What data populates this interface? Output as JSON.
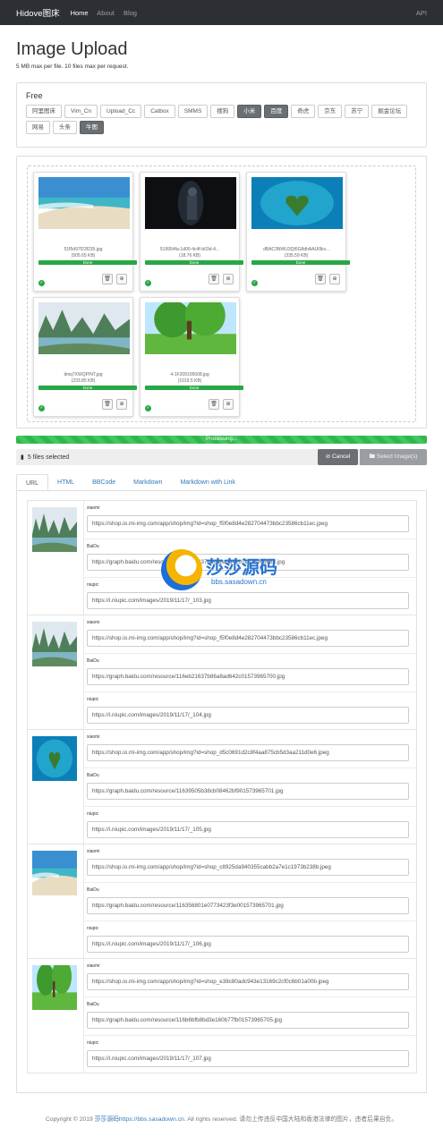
{
  "nav": {
    "brand": "Hidove图床",
    "home": "Home",
    "about": "About",
    "blog": "Blog",
    "api": "API"
  },
  "page": {
    "title": "Image Upload",
    "subtitle": "5 MB max per file. 10 files max per request."
  },
  "hosts": {
    "label": "Free",
    "items": [
      {
        "label": "阿里图床",
        "selected": false
      },
      {
        "label": "Vim_Cn",
        "selected": false
      },
      {
        "label": "Upload_Cc",
        "selected": false
      },
      {
        "label": "Catbox",
        "selected": false
      },
      {
        "label": "SMMS",
        "selected": false
      },
      {
        "label": "搜狗",
        "selected": false
      },
      {
        "label": "小米",
        "selected": true
      },
      {
        "label": "百度",
        "selected": true
      },
      {
        "label": "奇虎",
        "selected": false
      },
      {
        "label": "京东",
        "selected": false
      },
      {
        "label": "苏宁",
        "selected": false
      },
      {
        "label": "掘金论坛",
        "selected": false
      },
      {
        "label": "网易",
        "selected": false
      },
      {
        "label": "头条",
        "selected": false
      },
      {
        "label": "牛图",
        "selected": true
      }
    ]
  },
  "files": [
    {
      "name": "51f5d97f23f235.jpg",
      "size": "(505.65 KB)",
      "status": "Done",
      "progress": 1.0,
      "image": "beach"
    },
    {
      "name": "519954fa-1d00-4c4f-b03d-4...",
      "size": "(18.76 KB)",
      "status": "Done",
      "progress": 1.0,
      "image": "dark-figure"
    },
    {
      "name": "dBAC3NWU3Qt5G8dhAAUl9kv...",
      "size": "(335.59 KB)",
      "status": "Done",
      "progress": 1.0,
      "image": "heart-island"
    },
    {
      "name": "timq7XWQPINT.jpg",
      "size": "(233.85 KB)",
      "status": "Done",
      "progress": 1.0,
      "image": "river-hills"
    },
    {
      "name": "4-1F209105608.jpg",
      "size": "(1019.5 KB)",
      "status": "Done",
      "progress": 1.0,
      "image": "green-tree"
    }
  ],
  "progress": {
    "label": "Processing...",
    "value": 1.0
  },
  "selection": {
    "count_text": "5 files selected",
    "cancel": "Cancel",
    "select": "Select Image(s)"
  },
  "tabs": [
    "URL",
    "HTML",
    "BBCode",
    "Markdown",
    "Markdown with Link"
  ],
  "active_tab": "URL",
  "results": [
    {
      "image": "river-hills",
      "links": [
        {
          "host": "xiaomi",
          "url": "https://shop.io.mi-img.com/app/shop/img?id=shop_f5f0e8d4e282704473bbc23586cb11ec.jpeg"
        },
        {
          "host": "BaiDu",
          "url": "https://graph.baidu.com/resource/116eb21637b86a8ad642c01573965688.jpg"
        },
        {
          "host": "niupic",
          "url": "https://i.niupic.com/images/2019/11/17/_103.jpg"
        }
      ]
    },
    {
      "image": "river-hills",
      "links": [
        {
          "host": "xiaomi",
          "url": "https://shop.io.mi-img.com/app/shop/img?id=shop_f5f0e8d4e282704473bbc23586cb11ec.jpeg"
        },
        {
          "host": "BaiDu",
          "url": "https://graph.baidu.com/resource/116eb21637b86a8ad642c01573965700.jpg"
        },
        {
          "host": "niupic",
          "url": "https://i.niupic.com/images/2019/11/17/_104.jpg"
        }
      ]
    },
    {
      "image": "heart-island",
      "links": [
        {
          "host": "xiaomi",
          "url": "https://shop.io.mi-img.com/app/shop/img?id=shop_d5c0691d2c8f4aa875cb5d3aa211d0e6.jpeg"
        },
        {
          "host": "BaiDu",
          "url": "https://graph.baidu.com/resource/11639505b38cb08462bf901573965701.jpg"
        },
        {
          "host": "niupic",
          "url": "https://i.niupic.com/images/2019/11/17/_105.jpg"
        }
      ]
    },
    {
      "image": "beach",
      "links": [
        {
          "host": "xiaomi",
          "url": "https://shop.io.mi-img.com/app/shop/img?id=shop_c8925da940355cabb2a7e1c1973b238b.jpeg"
        },
        {
          "host": "BaiDu",
          "url": "https://graph.baidu.com/resource/116356801e0773423f3e001573965701.jpg"
        },
        {
          "host": "niupic",
          "url": "https://i.niupic.com/images/2019/11/17/_106.jpg"
        }
      ]
    },
    {
      "image": "green-tree",
      "links": [
        {
          "host": "xiaomi",
          "url": "https://shop.io.mi-img.com/app/shop/img?id=shop_e38c80adc943e13169c2cf0c6b01a00b.jpeg"
        },
        {
          "host": "BaiDu",
          "url": "https://graph.baidu.com/resource/116b6bfb8bd3e160b77fb01573965705.jpg"
        },
        {
          "host": "niupic",
          "url": "https://i.niupic.com/images/2019/11/17/_107.jpg"
        }
      ]
    }
  ],
  "watermark": {
    "title": "莎莎源码",
    "url": "bbs.sasadown.cn"
  },
  "footer": {
    "prefix": "Copyright © 2019 ",
    "link": "莎莎源码https://bbs.sasadown.cn",
    "suffix": ". All rights reserved. 请勿上传违反中国大陆和香港法律的图片，违者后果自负。"
  }
}
